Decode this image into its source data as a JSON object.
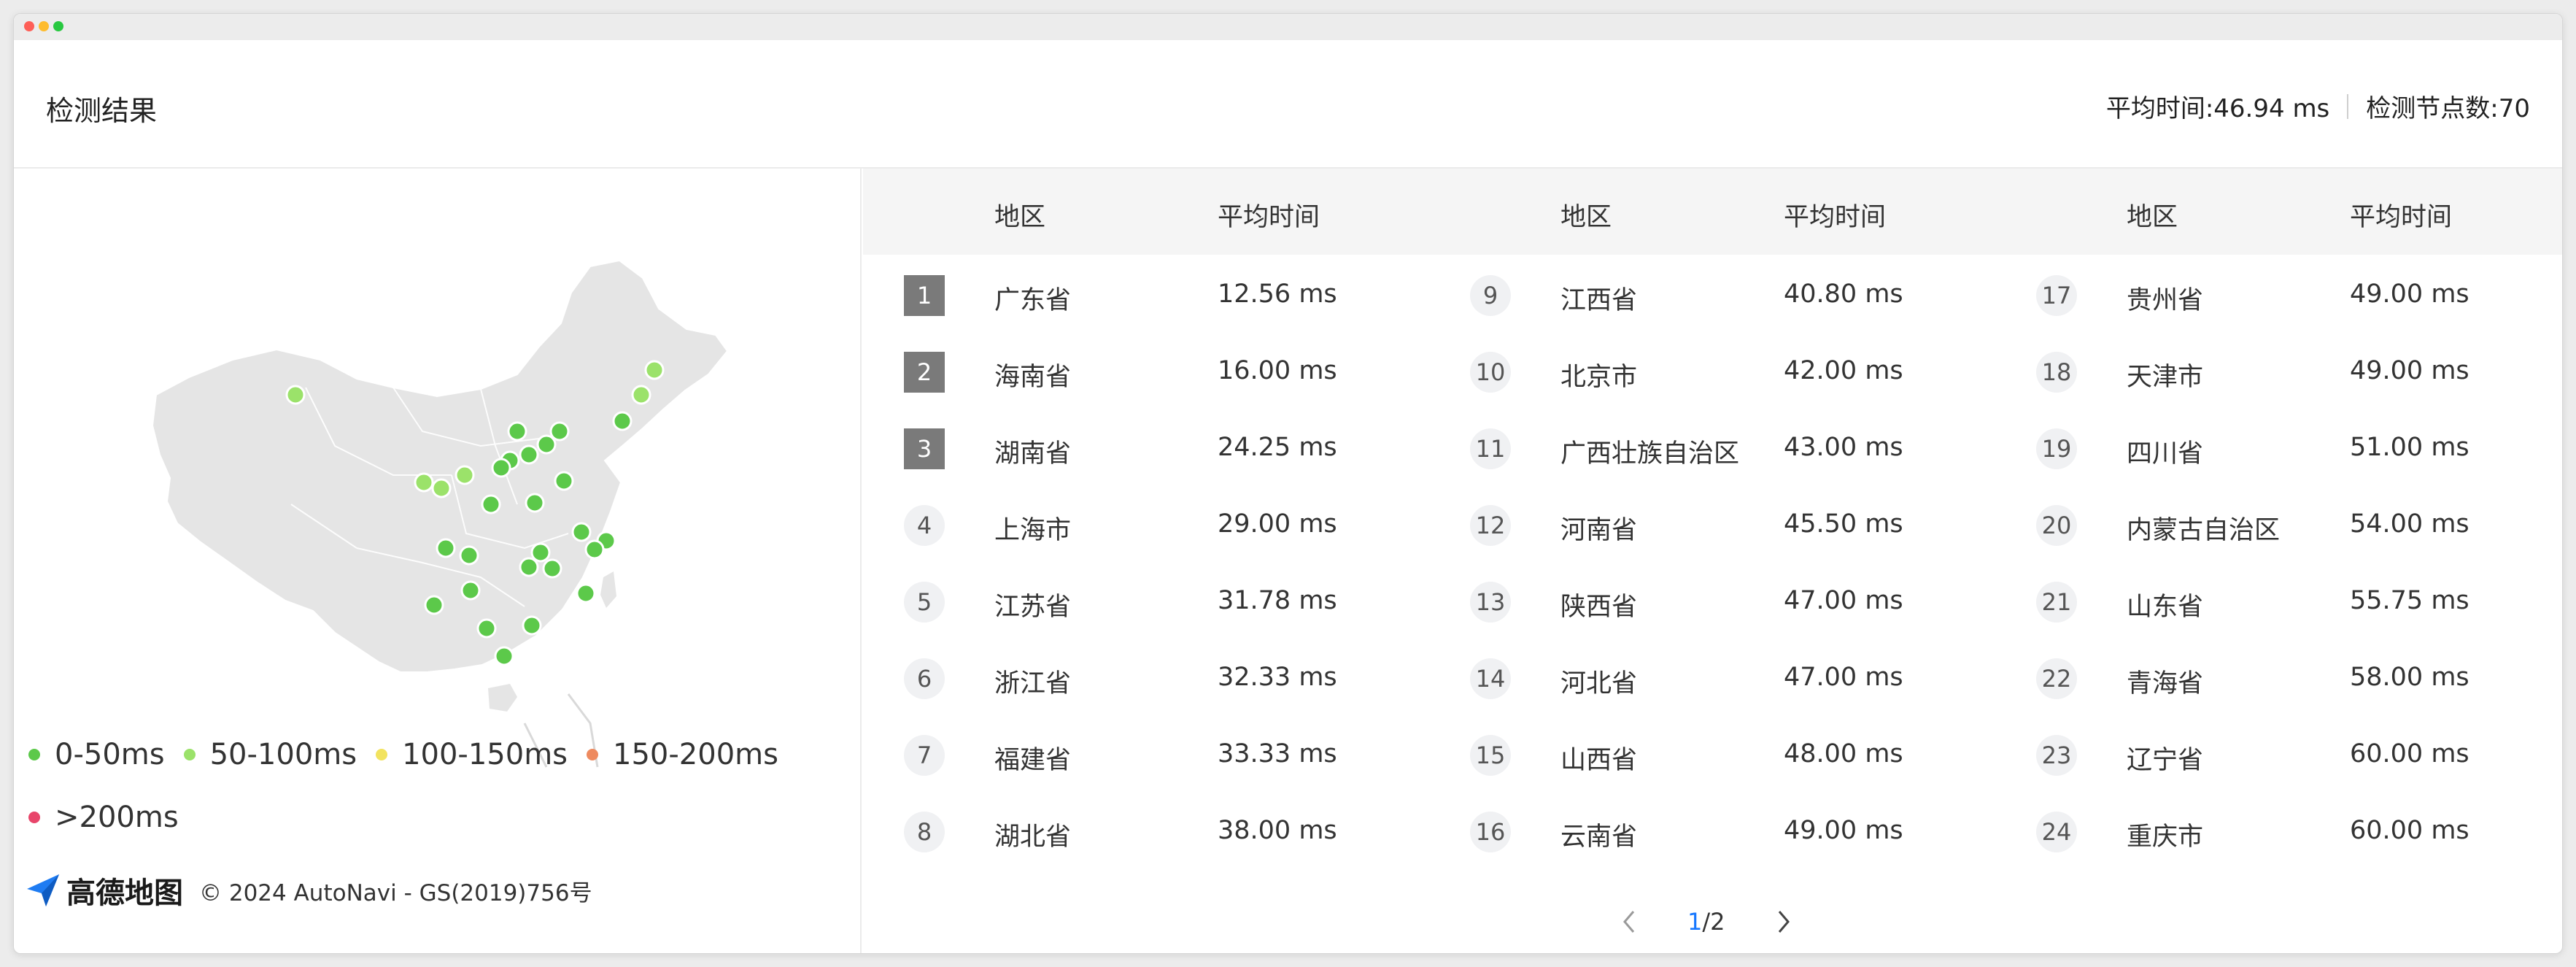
{
  "header": {
    "title": "检测结果",
    "avg_time": "平均时间:46.94 ms",
    "node_count": "检测节点数:70"
  },
  "colors": {
    "green": "#5cc94a",
    "light_green": "#9be26a",
    "yellow": "#f2e35f",
    "orange": "#ee8a5f",
    "red": "#e8456a"
  },
  "legend": [
    {
      "label": "0-50ms",
      "color": "#5cc94a"
    },
    {
      "label": "50-100ms",
      "color": "#9be26a"
    },
    {
      "label": "100-150ms",
      "color": "#f2e35f"
    },
    {
      "label": "150-200ms",
      "color": "#ee8a5f"
    },
    {
      "label": ">200ms",
      "color": "#e8456a"
    }
  ],
  "attribution": {
    "logo": "高德地图",
    "copyright": "© 2024 AutoNavi - GS(2019)756号"
  },
  "table": {
    "headers": {
      "region": "地区",
      "avg": "平均时间"
    },
    "columns": [
      [
        {
          "rank": "1",
          "region": "广东省",
          "time": "12.56 ms"
        },
        {
          "rank": "2",
          "region": "海南省",
          "time": "16.00 ms"
        },
        {
          "rank": "3",
          "region": "湖南省",
          "time": "24.25 ms"
        },
        {
          "rank": "4",
          "region": "上海市",
          "time": "29.00 ms"
        },
        {
          "rank": "5",
          "region": "江苏省",
          "time": "31.78 ms"
        },
        {
          "rank": "6",
          "region": "浙江省",
          "time": "32.33 ms"
        },
        {
          "rank": "7",
          "region": "福建省",
          "time": "33.33 ms"
        },
        {
          "rank": "8",
          "region": "湖北省",
          "time": "38.00 ms"
        }
      ],
      [
        {
          "rank": "9",
          "region": "江西省",
          "time": "40.80 ms"
        },
        {
          "rank": "10",
          "region": "北京市",
          "time": "42.00 ms"
        },
        {
          "rank": "11",
          "region": "广西壮族自治区",
          "time": "43.00 ms"
        },
        {
          "rank": "12",
          "region": "河南省",
          "time": "45.50 ms"
        },
        {
          "rank": "13",
          "region": "陕西省",
          "time": "47.00 ms"
        },
        {
          "rank": "14",
          "region": "河北省",
          "time": "47.00 ms"
        },
        {
          "rank": "15",
          "region": "山西省",
          "time": "48.00 ms"
        },
        {
          "rank": "16",
          "region": "云南省",
          "time": "49.00 ms"
        }
      ],
      [
        {
          "rank": "17",
          "region": "贵州省",
          "time": "49.00 ms"
        },
        {
          "rank": "18",
          "region": "天津市",
          "time": "49.00 ms"
        },
        {
          "rank": "19",
          "region": "四川省",
          "time": "51.00 ms"
        },
        {
          "rank": "20",
          "region": "内蒙古自治区",
          "time": "54.00 ms"
        },
        {
          "rank": "21",
          "region": "山东省",
          "time": "55.75 ms"
        },
        {
          "rank": "22",
          "region": "青海省",
          "time": "58.00 ms"
        },
        {
          "rank": "23",
          "region": "辽宁省",
          "time": "60.00 ms"
        },
        {
          "rank": "24",
          "region": "重庆市",
          "time": "60.00 ms"
        }
      ]
    ]
  },
  "pagination": {
    "current": "1",
    "total": "/2"
  }
}
